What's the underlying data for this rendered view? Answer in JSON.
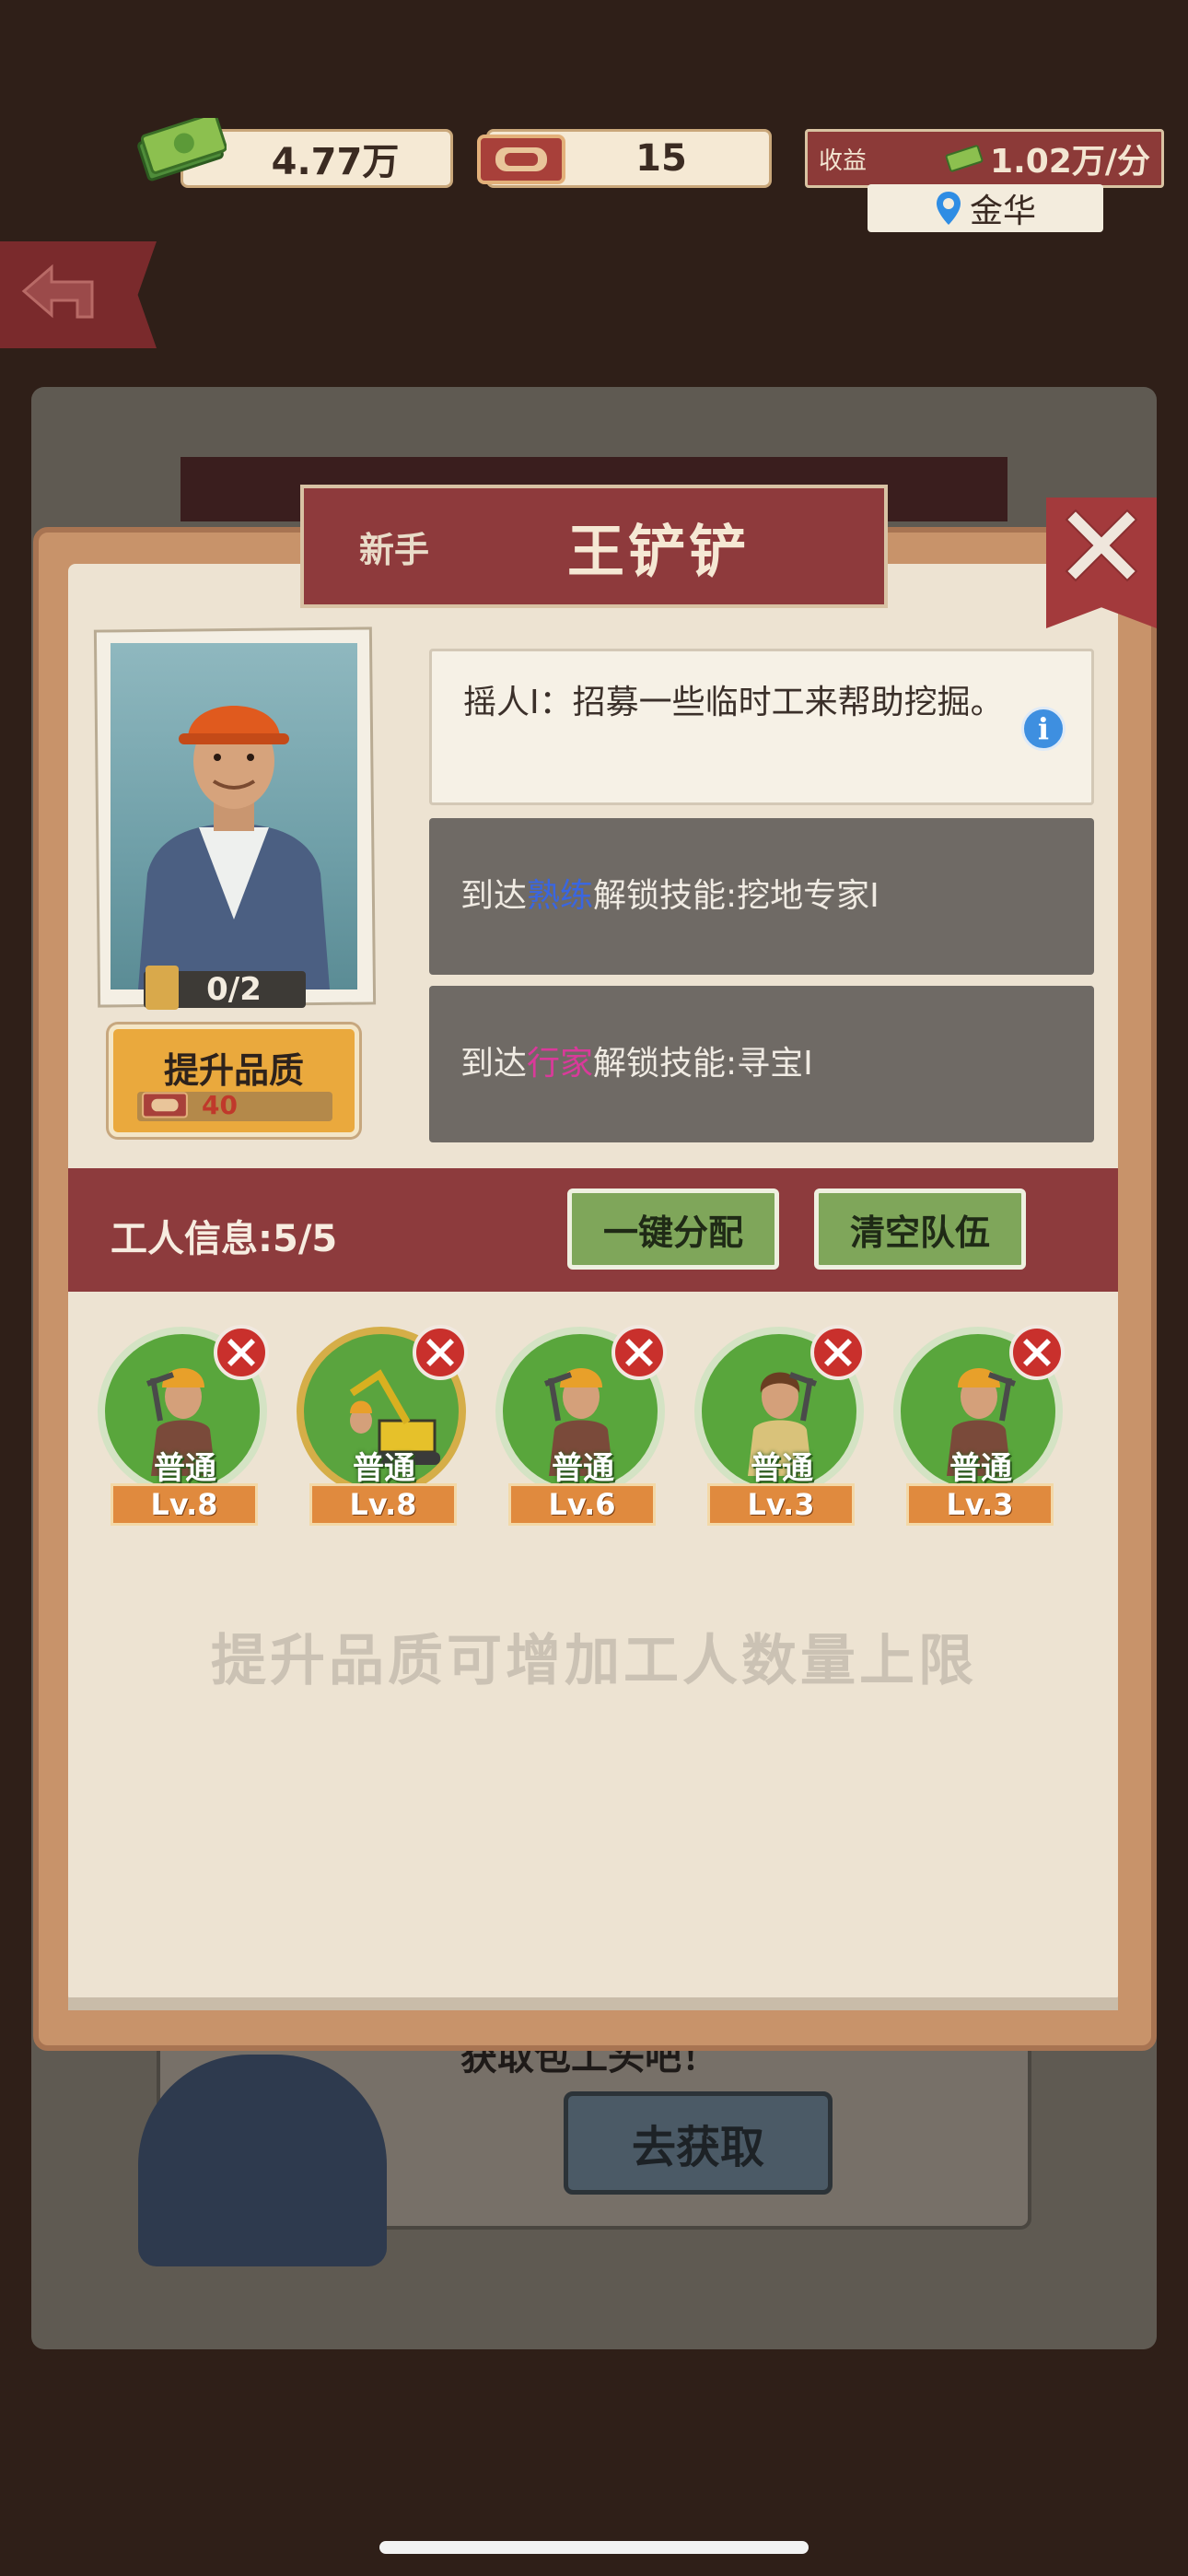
{
  "resources": {
    "cash": "4.77万",
    "tickets": "15",
    "income_label": "收益",
    "income_value": "1.02万/分",
    "location": "金华"
  },
  "background": {
    "card_text": "获取包工头吧！",
    "card_button": "去获取"
  },
  "dialog": {
    "rank": "新手",
    "name": "王铲铲",
    "shard_progress": "0/2",
    "upgrade_label": "提升品质",
    "upgrade_cost": "40",
    "skills": {
      "active": "摇人I：招募一些临时工来帮助挖掘。",
      "locked_1": {
        "prefix": "到达",
        "highlight": "熟练",
        "suffix": "解锁技能:挖地专家I"
      },
      "locked_2": {
        "prefix": "到达",
        "highlight": "行家",
        "suffix": "解锁技能:寻宝I"
      }
    },
    "worker_info": "工人信息:5/5",
    "auto_assign": "一键分配",
    "clear_team": "清空队伍",
    "workers": [
      {
        "quality": "普通",
        "level": "Lv.8",
        "icon": "pickaxe-worker"
      },
      {
        "quality": "普通",
        "level": "Lv.8",
        "icon": "excavator-worker"
      },
      {
        "quality": "普通",
        "level": "Lv.6",
        "icon": "pickaxe-worker"
      },
      {
        "quality": "普通",
        "level": "Lv.3",
        "icon": "female-pickaxe-worker"
      },
      {
        "quality": "普通",
        "level": "Lv.3",
        "icon": "pickaxe-worker"
      }
    ],
    "hint": "提升品质可增加工人数量上限"
  },
  "colors": {
    "banner": "#8e3a3c",
    "worker_circle": "#59a63c",
    "level_tag": "#e08a3e",
    "highlight_blue": "#3a66e0",
    "highlight_pink": "#d93a9a"
  }
}
